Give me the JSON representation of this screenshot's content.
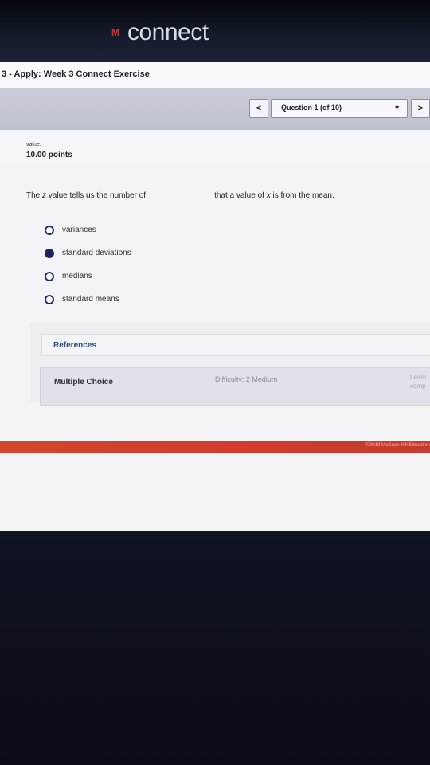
{
  "app": {
    "logo_text": "connect",
    "logo_mark": "M"
  },
  "assignment": {
    "title": "3 - Apply: Week 3 Connect Exercise"
  },
  "navigation": {
    "prev_label": "<",
    "next_label": ">",
    "question_select": "Question 1 (of 10)",
    "caret_icon": "caret-down-icon"
  },
  "value": {
    "label": "value:",
    "points": "10.00 points"
  },
  "question": {
    "part1": "The ",
    "z": "z",
    "part2": " value tells us the number of",
    "part3": "that a value of ",
    "x": "x",
    "part4": " is from the mean."
  },
  "options": [
    {
      "label": "variances",
      "selected": false
    },
    {
      "label": "standard deviations",
      "selected": true
    },
    {
      "label": "medians",
      "selected": false
    },
    {
      "label": "standard means",
      "selected": false
    }
  ],
  "references": {
    "title": "References",
    "type": "Multiple Choice",
    "difficulty": "Difficulty: 2 Medium",
    "learning_line1": "Learn",
    "learning_line2": "comp"
  },
  "footer": {
    "copyright": "©2019 McGraw-Hill Education"
  },
  "colors": {
    "accent_red": "#d3462c",
    "radio_selected": "#15265c",
    "nav_bar": "#c9ccd8"
  }
}
